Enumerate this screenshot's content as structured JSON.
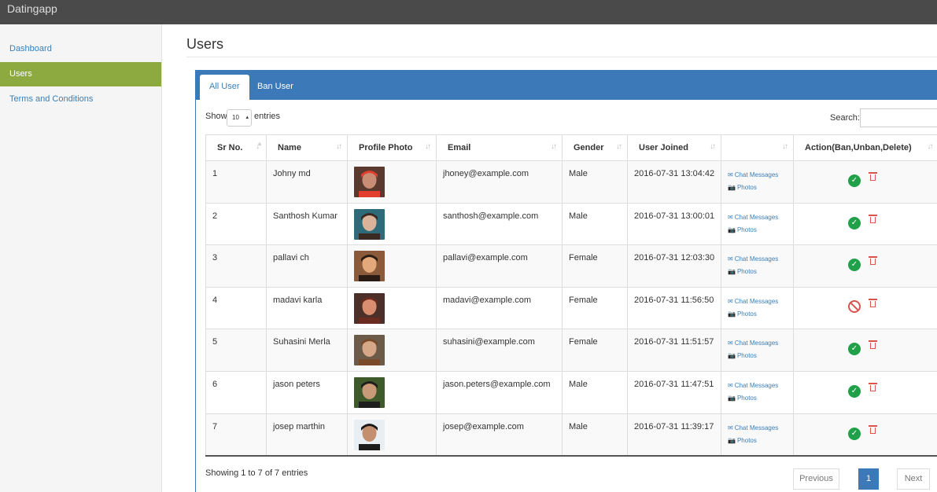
{
  "app": {
    "title": "Datingapp"
  },
  "sidebar": {
    "items": [
      {
        "label": "Dashboard",
        "active": false
      },
      {
        "label": "Users",
        "active": true
      },
      {
        "label": "Terms and Conditions",
        "active": false
      }
    ]
  },
  "page": {
    "title": "Users"
  },
  "tabs": [
    {
      "label": "All User",
      "active": true
    },
    {
      "label": "Ban User",
      "active": false
    }
  ],
  "table_controls": {
    "show_label": "Show",
    "entries_value": "10",
    "entries_suffix": "entries",
    "search_label": "Search:",
    "search_value": ""
  },
  "table": {
    "columns": [
      "Sr No.",
      "Name",
      "Profile Photo",
      "Email",
      "Gender",
      "User Joined",
      "",
      "Action(Ban,Unban,Delete)"
    ],
    "link_labels": {
      "chat": "Chat Messages",
      "photos": "Photos"
    },
    "rows": [
      {
        "sr": "1",
        "name": "Johny md",
        "email": "jhoney@example.com",
        "gender": "Male",
        "joined": "2016-07-31 13:04:42",
        "status": "active"
      },
      {
        "sr": "2",
        "name": "Santhosh Kumar",
        "email": "santhosh@example.com",
        "gender": "Male",
        "joined": "2016-07-31 13:00:01",
        "status": "active"
      },
      {
        "sr": "3",
        "name": "pallavi ch",
        "email": "pallavi@example.com",
        "gender": "Female",
        "joined": "2016-07-31 12:03:30",
        "status": "active"
      },
      {
        "sr": "4",
        "name": "madavi karla",
        "email": "madavi@example.com",
        "gender": "Female",
        "joined": "2016-07-31 11:56:50",
        "status": "banned"
      },
      {
        "sr": "5",
        "name": "Suhasini Merla",
        "email": "suhasini@example.com",
        "gender": "Female",
        "joined": "2016-07-31 11:51:57",
        "status": "active"
      },
      {
        "sr": "6",
        "name": "jason peters",
        "email": "jason.peters@example.com",
        "gender": "Male",
        "joined": "2016-07-31 11:47:51",
        "status": "active"
      },
      {
        "sr": "7",
        "name": "josep marthin",
        "email": "josep@example.com",
        "gender": "Male",
        "joined": "2016-07-31 11:39:17",
        "status": "active"
      }
    ]
  },
  "footer": {
    "info": "Showing 1 to 7 of 7 entries",
    "prev": "Previous",
    "page": "1",
    "next": "Next"
  },
  "colors": {
    "topbar": "#4a4a4a",
    "sidebar_active": "#8caa3f",
    "primary": "#3b79b8",
    "ok": "#20a049",
    "danger": "#d9534f"
  },
  "icons": {
    "chat": "envelope-icon",
    "photos": "camera-icon",
    "active": "check-circle-icon",
    "banned": "ban-icon",
    "delete": "trash-icon"
  }
}
